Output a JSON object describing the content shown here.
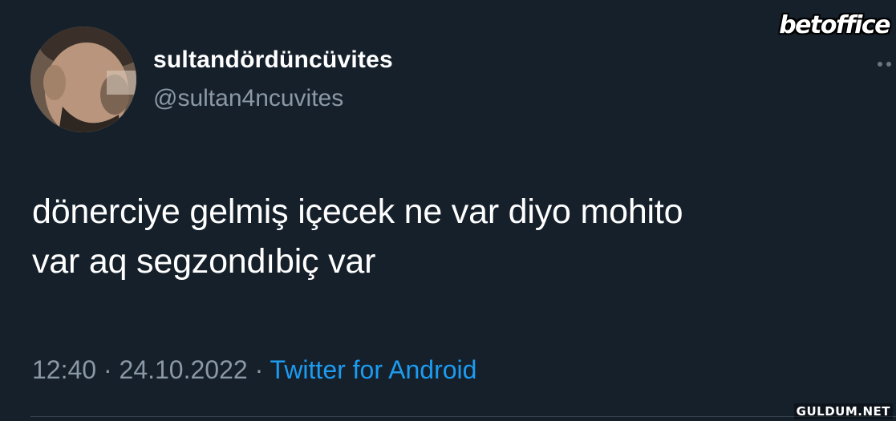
{
  "tweet": {
    "display_name": "sultandördüncüvites",
    "handle": "@sultan4ncuvites",
    "text_line1": "dönerciye gelmiş içecek ne var diyo mohito",
    "text_line2": "var aq segzondıbiç var",
    "time": "12:40",
    "separator1": " · ",
    "date": "24.10.2022",
    "separator2": " · ",
    "source": "Twitter for Android",
    "more_icon": "more-horizontal-icon"
  },
  "watermarks": {
    "brand": "betoffice",
    "site": "GULDUM.NET"
  },
  "colors": {
    "background": "#15202b",
    "primary_text": "#ffffff",
    "secondary_text": "#8b98a5",
    "link": "#1d9bf0"
  }
}
